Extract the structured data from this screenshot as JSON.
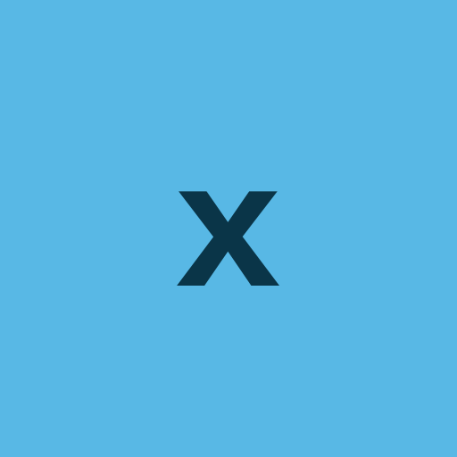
{
  "avatar": {
    "letter": "x",
    "background_color": "#58B8E5",
    "letter_color": "#0A3548"
  }
}
